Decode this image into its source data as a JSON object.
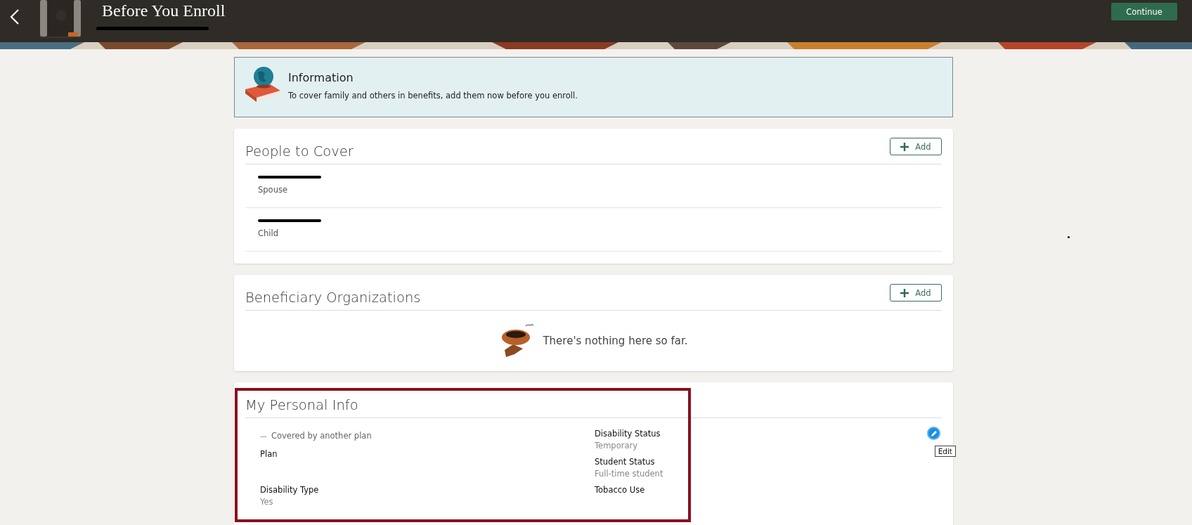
{
  "header": {
    "title": "Before You Enroll",
    "subtitle_redacted": true,
    "continue_button": "Continue"
  },
  "information": {
    "title": "Information",
    "message": "To cover family and others in benefits, add them now before you enroll."
  },
  "people_to_cover": {
    "title": "People to Cover",
    "add_button": "Add",
    "people": [
      {
        "name_redacted": true,
        "relationship": "Spouse"
      },
      {
        "name_redacted": true,
        "relationship": "Child"
      }
    ]
  },
  "beneficiary_organizations": {
    "title": "Beneficiary Organizations",
    "add_button": "Add",
    "empty_message": "There's nothing here so far."
  },
  "personal_info": {
    "title": "My Personal Info",
    "highlighted": true,
    "edit_tooltip": "Edit",
    "left_fields": [
      {
        "kind": "flag",
        "marker": "—",
        "label": "Covered by another plan"
      },
      {
        "kind": "field",
        "label": "Plan"
      },
      {
        "kind": "field",
        "label": "Disability Type",
        "value": "Yes"
      }
    ],
    "right_fields": [
      {
        "kind": "field",
        "label": "Disability Status",
        "value": "Temporary"
      },
      {
        "kind": "field",
        "label": "Student Status",
        "value": "Full-time student"
      },
      {
        "kind": "field",
        "label": "Tobacco Use"
      }
    ]
  }
}
